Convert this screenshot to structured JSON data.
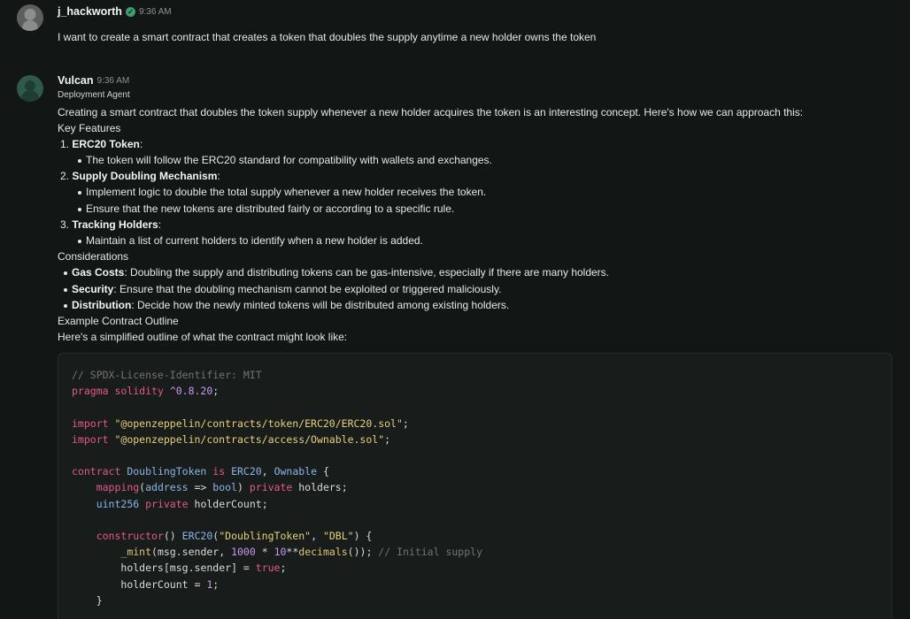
{
  "messages": [
    {
      "author": "j_hackworth",
      "time": "9:36 AM",
      "text": "I want to create a smart contract that creates a token that doubles the supply anytime a new holder owns the token"
    },
    {
      "author": "Vulcan",
      "time": "9:36 AM",
      "role": "Deployment Agent",
      "intro": "Creating a smart contract that doubles the token supply whenever a new holder acquires the token is an interesting concept. Here's how we can approach this:",
      "key_features_heading": "Key Features",
      "features": [
        {
          "num": "1.",
          "title": "ERC20 Token",
          "bullets": [
            "The token will follow the ERC20 standard for compatibility with wallets and exchanges."
          ]
        },
        {
          "num": "2.",
          "title": "Supply Doubling Mechanism",
          "bullets": [
            "Implement logic to double the total supply whenever a new holder receives the token.",
            "Ensure that the new tokens are distributed fairly or according to a specific rule."
          ]
        },
        {
          "num": "3.",
          "title": "Tracking Holders",
          "bullets": [
            "Maintain a list of current holders to identify when a new holder is added."
          ]
        }
      ],
      "considerations_heading": "Considerations",
      "considerations": [
        {
          "title": "Gas Costs",
          "text": ": Doubling the supply and distributing tokens can be gas-intensive, especially if there are many holders."
        },
        {
          "title": "Security",
          "text": ": Ensure that the doubling mechanism cannot be exploited or triggered maliciously."
        },
        {
          "title": "Distribution",
          "text": ": Decide how the newly minted tokens will be distributed among existing holders."
        }
      ],
      "outline_heading": "Example Contract Outline",
      "outline_intro": "Here's a simplified outline of what the contract might look like:",
      "code_lines": [
        "// SPDX-License-Identifier: MIT",
        "pragma solidity ^0.8.20;",
        "",
        "import \"@openzeppelin/contracts/token/ERC20/ERC20.sol\";",
        "import \"@openzeppelin/contracts/access/Ownable.sol\";",
        "",
        "contract DoublingToken is ERC20, Ownable {",
        "    mapping(address => bool) private holders;",
        "    uint256 private holderCount;",
        "",
        "    constructor() ERC20(\"DoublingToken\", \"DBL\") {",
        "        _mint(msg.sender, 1000 * 10**decimals()); // Initial supply",
        "        holders[msg.sender] = true;",
        "        holderCount = 1;",
        "    }"
      ]
    }
  ],
  "icons": {
    "verified": "check-badge-icon"
  },
  "colors": {
    "background": "#121615",
    "code_background": "#181c1b",
    "keyword": "#e5588d",
    "string": "#e6d07a",
    "type": "#8ab6e8",
    "number": "#c79bf2",
    "comment": "#6e7673",
    "verified_badge": "#3f9b72"
  }
}
